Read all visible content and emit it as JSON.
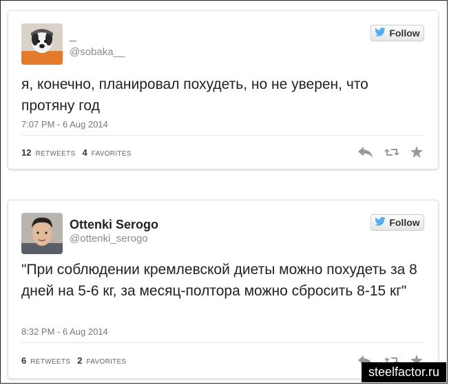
{
  "tweets": [
    {
      "name": "_",
      "handle": "@sobaka__",
      "follow_label": "Follow",
      "text": "я, конечно, планировал похудеть, но не уверен, что протяну год",
      "timestamp": "7:07 PM - 6 Aug 2014",
      "retweets_count": "12",
      "retweets_label": "RETWEETS",
      "favorites_count": "4",
      "favorites_label": "FAVORITES"
    },
    {
      "name": "Ottenki Serogo",
      "handle": "@ottenki_serogo",
      "follow_label": "Follow",
      "text": "\"При соблюдении кремлевской диеты можно похудеть за 8 дней на 5-6 кг, за месяц-полтора можно сбросить 8-15 кг\"",
      "timestamp": "8:32 PM - 6 Aug 2014",
      "retweets_count": "6",
      "retweets_label": "RETWEETS",
      "favorites_count": "2",
      "favorites_label": "FAVORITES"
    }
  ],
  "watermark": "steelfactor.ru",
  "colors": {
    "twitter_blue": "#55acee",
    "action_gray": "#999999"
  }
}
